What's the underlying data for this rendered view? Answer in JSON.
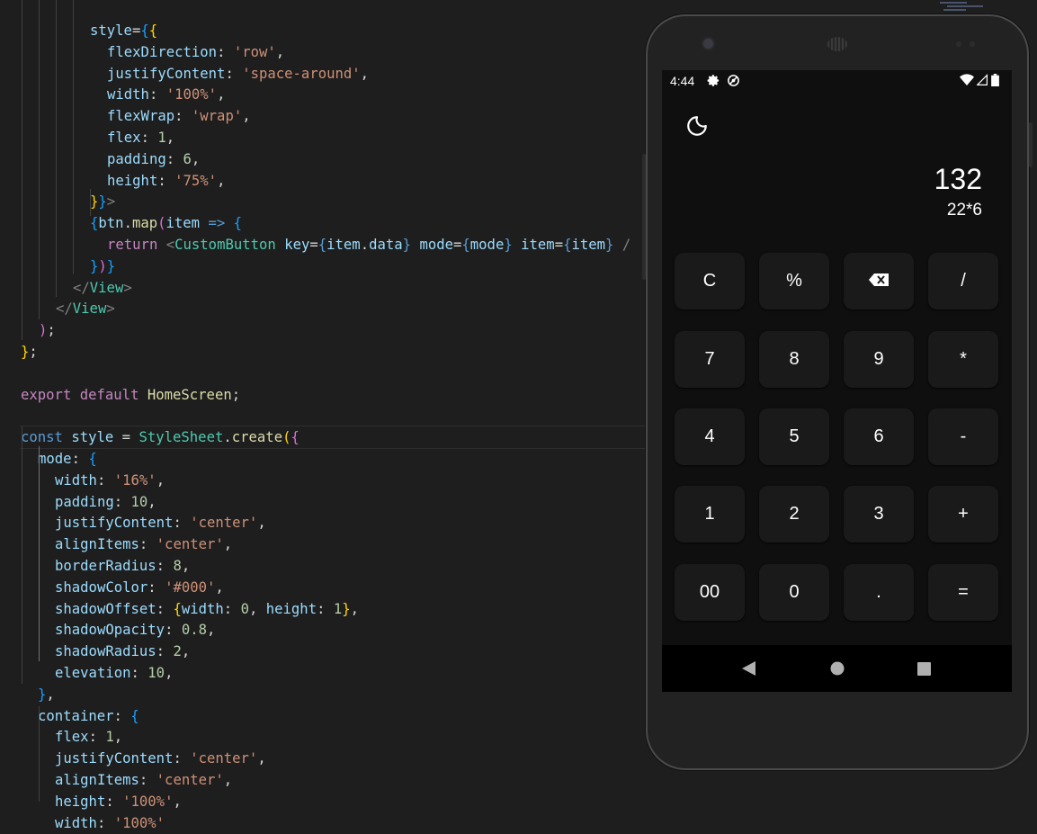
{
  "editor": {
    "lines": [
      [
        [
          "tok-v",
          "style"
        ],
        [
          "tok-d",
          "="
        ],
        [
          "tok-b",
          "{"
        ],
        [
          "tok-y",
          "{"
        ]
      ],
      [
        [
          "tok-v",
          "flexDirection"
        ],
        [
          "tok-d",
          ": "
        ],
        [
          "tok-s",
          "'row'"
        ],
        [
          "tok-d",
          ","
        ]
      ],
      [
        [
          "tok-v",
          "justifyContent"
        ],
        [
          "tok-d",
          ": "
        ],
        [
          "tok-s",
          "'space-around'"
        ],
        [
          "tok-d",
          ","
        ]
      ],
      [
        [
          "tok-v",
          "width"
        ],
        [
          "tok-d",
          ": "
        ],
        [
          "tok-s",
          "'100%'"
        ],
        [
          "tok-d",
          ","
        ]
      ],
      [
        [
          "tok-v",
          "flexWrap"
        ],
        [
          "tok-d",
          ": "
        ],
        [
          "tok-s",
          "'wrap'"
        ],
        [
          "tok-d",
          ","
        ]
      ],
      [
        [
          "tok-v",
          "flex"
        ],
        [
          "tok-d",
          ": "
        ],
        [
          "tok-n",
          "1"
        ],
        [
          "tok-d",
          ","
        ]
      ],
      [
        [
          "tok-v",
          "padding"
        ],
        [
          "tok-d",
          ": "
        ],
        [
          "tok-n",
          "6"
        ],
        [
          "tok-d",
          ","
        ]
      ],
      [
        [
          "tok-v",
          "height"
        ],
        [
          "tok-d",
          ": "
        ],
        [
          "tok-s",
          "'75%'"
        ],
        [
          "tok-d",
          ","
        ]
      ],
      [
        [
          "tok-y",
          "}"
        ],
        [
          "tok-b",
          "}"
        ],
        [
          "tok-tag",
          ">"
        ]
      ],
      [
        [
          "tok-b",
          "{"
        ],
        [
          "tok-v",
          "btn"
        ],
        [
          "tok-d",
          "."
        ],
        [
          "tok-f",
          "map"
        ],
        [
          "tok-m",
          "("
        ],
        [
          "tok-v",
          "item"
        ],
        [
          "tok-d",
          " "
        ],
        [
          "tok-c",
          "=>"
        ],
        [
          "tok-d",
          " "
        ],
        [
          "tok-b",
          "{"
        ]
      ],
      [
        [
          "tok-k",
          "return"
        ],
        [
          "tok-d",
          " "
        ],
        [
          "tok-tag",
          "<"
        ],
        [
          "tok-t",
          "CustomButton"
        ],
        [
          "tok-d",
          " "
        ],
        [
          "tok-v",
          "key"
        ],
        [
          "tok-d",
          "="
        ],
        [
          "tok-c",
          "{"
        ],
        [
          "tok-v",
          "item"
        ],
        [
          "tok-d",
          "."
        ],
        [
          "tok-v",
          "data"
        ],
        [
          "tok-c",
          "}"
        ],
        [
          "tok-d",
          " "
        ],
        [
          "tok-v",
          "mode"
        ],
        [
          "tok-d",
          "="
        ],
        [
          "tok-c",
          "{"
        ],
        [
          "tok-v",
          "mode"
        ],
        [
          "tok-c",
          "}"
        ],
        [
          "tok-d",
          " "
        ],
        [
          "tok-v",
          "item"
        ],
        [
          "tok-d",
          "="
        ],
        [
          "tok-c",
          "{"
        ],
        [
          "tok-v",
          "item"
        ],
        [
          "tok-c",
          "}"
        ],
        [
          "tok-d",
          " "
        ],
        [
          "tok-tag",
          "/"
        ]
      ],
      [
        [
          "tok-b",
          "}"
        ],
        [
          "tok-m",
          ")"
        ],
        [
          "tok-b",
          "}"
        ]
      ],
      [
        [
          "tok-tag",
          "</"
        ],
        [
          "tok-t",
          "View"
        ],
        [
          "tok-tag",
          ">"
        ]
      ],
      [
        [
          "tok-tag",
          "</"
        ],
        [
          "tok-t",
          "View"
        ],
        [
          "tok-tag",
          ">"
        ]
      ],
      [
        [
          "tok-m",
          ")"
        ],
        [
          "tok-d",
          ";"
        ]
      ],
      [
        [
          "tok-y",
          "}"
        ],
        [
          "tok-d",
          ";"
        ]
      ],
      [],
      [
        [
          "tok-k",
          "export"
        ],
        [
          "tok-d",
          " "
        ],
        [
          "tok-k",
          "default"
        ],
        [
          "tok-d",
          " "
        ],
        [
          "tok-f",
          "HomeScreen"
        ],
        [
          "tok-d",
          ";"
        ]
      ],
      [],
      [
        [
          "tok-c",
          "const"
        ],
        [
          "tok-d",
          " "
        ],
        [
          "tok-v",
          "style"
        ],
        [
          "tok-d",
          " = "
        ],
        [
          "tok-t",
          "StyleSheet"
        ],
        [
          "tok-d",
          "."
        ],
        [
          "tok-f",
          "create"
        ],
        [
          "tok-y",
          "("
        ],
        [
          "tok-m",
          "{"
        ]
      ],
      [
        [
          "tok-v",
          "mode"
        ],
        [
          "tok-d",
          ": "
        ],
        [
          "tok-b",
          "{"
        ]
      ],
      [
        [
          "tok-v",
          "width"
        ],
        [
          "tok-d",
          ": "
        ],
        [
          "tok-s",
          "'16%'"
        ],
        [
          "tok-d",
          ","
        ]
      ],
      [
        [
          "tok-v",
          "padding"
        ],
        [
          "tok-d",
          ": "
        ],
        [
          "tok-n",
          "10"
        ],
        [
          "tok-d",
          ","
        ]
      ],
      [
        [
          "tok-v",
          "justifyContent"
        ],
        [
          "tok-d",
          ": "
        ],
        [
          "tok-s",
          "'center'"
        ],
        [
          "tok-d",
          ","
        ]
      ],
      [
        [
          "tok-v",
          "alignItems"
        ],
        [
          "tok-d",
          ": "
        ],
        [
          "tok-s",
          "'center'"
        ],
        [
          "tok-d",
          ","
        ]
      ],
      [
        [
          "tok-v",
          "borderRadius"
        ],
        [
          "tok-d",
          ": "
        ],
        [
          "tok-n",
          "8"
        ],
        [
          "tok-d",
          ","
        ]
      ],
      [
        [
          "tok-v",
          "shadowColor"
        ],
        [
          "tok-d",
          ": "
        ],
        [
          "tok-s",
          "'#000'"
        ],
        [
          "tok-d",
          ","
        ]
      ],
      [
        [
          "tok-v",
          "shadowOffset"
        ],
        [
          "tok-d",
          ": "
        ],
        [
          "tok-y",
          "{"
        ],
        [
          "tok-v",
          "width"
        ],
        [
          "tok-d",
          ": "
        ],
        [
          "tok-n",
          "0"
        ],
        [
          "tok-d",
          ", "
        ],
        [
          "tok-v",
          "height"
        ],
        [
          "tok-d",
          ": "
        ],
        [
          "tok-n",
          "1"
        ],
        [
          "tok-y",
          "}"
        ],
        [
          "tok-d",
          ","
        ]
      ],
      [
        [
          "tok-v",
          "shadowOpacity"
        ],
        [
          "tok-d",
          ": "
        ],
        [
          "tok-n",
          "0.8"
        ],
        [
          "tok-d",
          ","
        ]
      ],
      [
        [
          "tok-v",
          "shadowRadius"
        ],
        [
          "tok-d",
          ": "
        ],
        [
          "tok-n",
          "2"
        ],
        [
          "tok-d",
          ","
        ]
      ],
      [
        [
          "tok-v",
          "elevation"
        ],
        [
          "tok-d",
          ": "
        ],
        [
          "tok-n",
          "10"
        ],
        [
          "tok-d",
          ","
        ]
      ],
      [
        [
          "tok-b",
          "}"
        ],
        [
          "tok-d",
          ","
        ]
      ],
      [
        [
          "tok-v",
          "container"
        ],
        [
          "tok-d",
          ": "
        ],
        [
          "tok-b",
          "{"
        ]
      ],
      [
        [
          "tok-v",
          "flex"
        ],
        [
          "tok-d",
          ": "
        ],
        [
          "tok-n",
          "1"
        ],
        [
          "tok-d",
          ","
        ]
      ],
      [
        [
          "tok-v",
          "justifyContent"
        ],
        [
          "tok-d",
          ": "
        ],
        [
          "tok-s",
          "'center'"
        ],
        [
          "tok-d",
          ","
        ]
      ],
      [
        [
          "tok-v",
          "alignItems"
        ],
        [
          "tok-d",
          ": "
        ],
        [
          "tok-s",
          "'center'"
        ],
        [
          "tok-d",
          ","
        ]
      ],
      [
        [
          "tok-v",
          "height"
        ],
        [
          "tok-d",
          ": "
        ],
        [
          "tok-s",
          "'100%'"
        ],
        [
          "tok-d",
          ","
        ]
      ],
      [
        [
          "tok-v",
          "width"
        ],
        [
          "tok-d",
          ": "
        ],
        [
          "tok-s",
          "'100%'"
        ]
      ]
    ]
  },
  "phone": {
    "status": {
      "time": "4:44"
    },
    "display": {
      "result": "132",
      "expression": "22*6"
    },
    "keys": [
      "C",
      "%",
      "backspace",
      "/",
      "7",
      "8",
      "9",
      "*",
      "4",
      "5",
      "6",
      "-",
      "1",
      "2",
      "3",
      "+",
      "00",
      "0",
      ".",
      "="
    ],
    "icons": {
      "theme_toggle": "moon-icon",
      "backspace": "backspace-icon",
      "nav": [
        "back-icon",
        "home-icon",
        "recents-icon"
      ],
      "status": [
        "gear-icon",
        "do-not-disturb-icon",
        "wifi-icon",
        "signal-icon",
        "battery-icon"
      ]
    }
  }
}
